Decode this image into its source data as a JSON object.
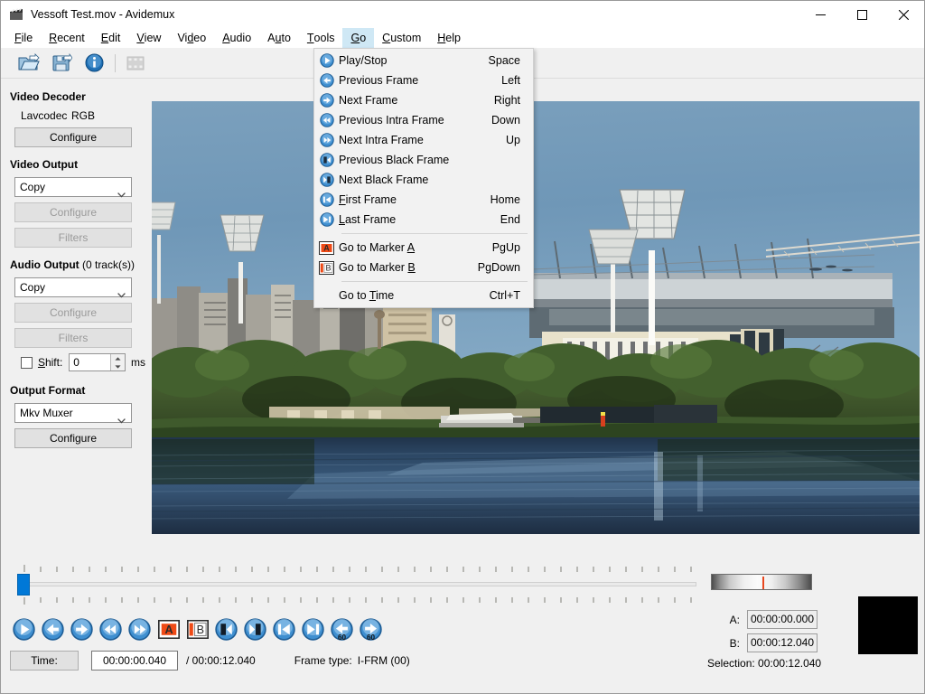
{
  "window": {
    "title": "Vessoft Test.mov - Avidemux",
    "icon": "clapperboard-icon",
    "minimize": "—",
    "maximize": "☐",
    "close": "✕"
  },
  "menubar": {
    "items": [
      {
        "label": "File",
        "accel": "F",
        "name": "menu-file"
      },
      {
        "label": "Recent",
        "accel": "R",
        "name": "menu-recent"
      },
      {
        "label": "Edit",
        "accel": "E",
        "name": "menu-edit"
      },
      {
        "label": "View",
        "accel": "V",
        "name": "menu-view"
      },
      {
        "label": "Video",
        "accel": "d",
        "name": "menu-video"
      },
      {
        "label": "Audio",
        "accel": "A",
        "name": "menu-audio"
      },
      {
        "label": "Auto",
        "accel": "u",
        "name": "menu-auto"
      },
      {
        "label": "Tools",
        "accel": "T",
        "name": "menu-tools"
      },
      {
        "label": "Go",
        "accel": "G",
        "name": "menu-go",
        "active": true
      },
      {
        "label": "Custom",
        "accel": "C",
        "name": "menu-custom"
      },
      {
        "label": "Help",
        "accel": "H",
        "name": "menu-help"
      }
    ]
  },
  "toolbar": {
    "buttons": [
      {
        "name": "open-file-icon",
        "tip": "Open"
      },
      {
        "name": "save-file-icon",
        "tip": "Save"
      },
      {
        "name": "info-icon",
        "tip": "Properties"
      },
      {
        "name": "film-strip-icon",
        "tip": "Calculator",
        "disabled": true
      }
    ]
  },
  "go_menu": {
    "items": [
      {
        "label": "Play/Stop",
        "key": "Space",
        "icon": "play-circle-icon",
        "accel": ""
      },
      {
        "label": "Previous Frame",
        "key": "Left",
        "icon": "arrow-left-circle-icon",
        "accel": ""
      },
      {
        "label": "Next Frame",
        "key": "Right",
        "icon": "arrow-right-circle-icon",
        "accel": ""
      },
      {
        "label": "Previous Intra Frame",
        "key": "Down",
        "icon": "rewind-circle-icon",
        "accel": ""
      },
      {
        "label": "Next Intra Frame",
        "key": "Up",
        "icon": "forward-circle-icon",
        "accel": ""
      },
      {
        "label": "Previous Black Frame",
        "key": "",
        "icon": "prev-black-circle-icon",
        "accel": ""
      },
      {
        "label": "Next Black Frame",
        "key": "",
        "icon": "next-black-circle-icon",
        "accel": ""
      },
      {
        "label": "First Frame",
        "key": "Home",
        "icon": "skip-start-circle-icon",
        "accel": "F"
      },
      {
        "label": "Last Frame",
        "key": "End",
        "icon": "skip-end-circle-icon",
        "accel": "L"
      },
      {
        "separator": true
      },
      {
        "label": "Go to Marker A",
        "key": "PgUp",
        "icon": "marker-a-icon",
        "accel": "A"
      },
      {
        "label": "Go to Marker B",
        "key": "PgDown",
        "icon": "marker-b-icon",
        "accel": "B"
      },
      {
        "separator": true
      },
      {
        "label": "Go to Time",
        "key": "Ctrl+T",
        "icon": "",
        "accel": "T"
      }
    ]
  },
  "sidebar": {
    "video_decoder": {
      "header": "Video Decoder",
      "codec": "Lavcodec",
      "colorspace": "RGB",
      "configure": "Configure"
    },
    "video_output": {
      "header": "Video Output",
      "selected": "Copy",
      "configure": "Configure",
      "filters": "Filters"
    },
    "audio_output": {
      "header": "Audio Output",
      "track_count": " (0 track(s))",
      "selected": "Copy",
      "configure": "Configure",
      "filters": "Filters",
      "shift_label": "Shift:",
      "shift_accel": "S",
      "shift_value": "0",
      "shift_units": "ms",
      "shift_checked": false
    },
    "output_format": {
      "header": "Output Format",
      "selected": "Mkv Muxer",
      "configure": "Configure"
    }
  },
  "player": {
    "buttons": [
      {
        "name": "play-button",
        "icon": "play-circle-icon"
      },
      {
        "name": "previous-frame-button",
        "icon": "arrow-left-circle-icon"
      },
      {
        "name": "next-frame-button",
        "icon": "arrow-right-circle-icon"
      },
      {
        "name": "previous-intra-button",
        "icon": "rewind-circle-icon"
      },
      {
        "name": "next-intra-button",
        "icon": "forward-circle-icon"
      },
      {
        "name": "set-marker-a-button",
        "icon": "marker-a-icon"
      },
      {
        "name": "set-marker-b-button",
        "icon": "marker-b-icon"
      },
      {
        "name": "previous-black-button",
        "icon": "prev-black-circle-icon"
      },
      {
        "name": "next-black-button",
        "icon": "next-black-circle-icon"
      },
      {
        "name": "first-frame-button",
        "icon": "skip-start-circle-icon"
      },
      {
        "name": "last-frame-button",
        "icon": "skip-end-circle-icon"
      },
      {
        "name": "back-60s-button",
        "icon": "back-60s-circle-icon"
      },
      {
        "name": "forward-60s-button",
        "icon": "forward-60s-circle-icon"
      }
    ],
    "slider_position_percent": 0
  },
  "status": {
    "time_label": "Time:",
    "current_time": "00:00:00.040",
    "total_time": "/ 00:00:12.040",
    "frame_type_label": "Frame type:",
    "frame_type_value": "I-FRM (00)"
  },
  "markers": {
    "a_label": "A:",
    "a_value": "00:00:00.000",
    "b_label": "B:",
    "b_value": "00:00:12.040",
    "selection": "Selection: 00:00:12.040"
  },
  "colors": {
    "accent": "#0078d7",
    "menu_highlight": "#cfe8f5",
    "marker_red": "#e8471f",
    "window_bg": "#f0f0f0"
  },
  "video_preview": {
    "description": "Melbourne Yarra River with MCG stadium and city buildings under a clear blue sky"
  }
}
